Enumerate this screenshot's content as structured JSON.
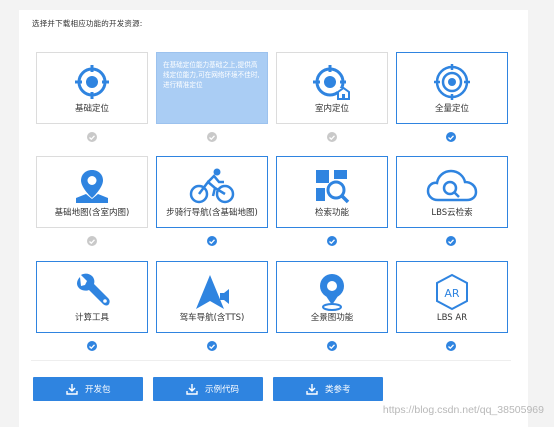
{
  "colors": {
    "accent": "#2f84e0",
    "info_bg": "#aacdf4",
    "unselected": "#c9c9c9"
  },
  "title": "选择并下载相应功能的开发资源:",
  "cards": [
    {
      "label": "基础定位",
      "icon": "crosshair-icon",
      "selected": false
    },
    {
      "label": "",
      "icon": "",
      "selected": false,
      "info_text": "在基础定位能力基础之上,提供高线定位能力,可在网络环境不佳时,进行精准定位"
    },
    {
      "label": "室内定位",
      "icon": "indoor-locate-icon",
      "selected": false
    },
    {
      "label": "全量定位",
      "icon": "full-locate-icon",
      "selected": true
    },
    {
      "label": "基础地图(含室内图)",
      "icon": "map-pin-icon",
      "selected": false
    },
    {
      "label": "步骑行导航(含基础地图)",
      "icon": "bicycle-icon",
      "selected": true
    },
    {
      "label": "检索功能",
      "icon": "search-grid-icon",
      "selected": true
    },
    {
      "label": "LBS云检索",
      "icon": "cloud-search-icon",
      "selected": true
    },
    {
      "label": "计算工具",
      "icon": "wrench-icon",
      "selected": true
    },
    {
      "label": "驾车导航(含TTS)",
      "icon": "nav-arrow-icon",
      "selected": true
    },
    {
      "label": "全景图功能",
      "icon": "panorama-pin-icon",
      "selected": true
    },
    {
      "label": "LBS AR",
      "icon": "ar-hex-icon",
      "selected": true
    }
  ],
  "buttons": [
    {
      "label": "开发包",
      "icon": "download-icon"
    },
    {
      "label": "示例代码",
      "icon": "download-icon"
    },
    {
      "label": "类参考",
      "icon": "download-icon"
    }
  ],
  "watermark": "https://blog.csdn.net/qq_38505969"
}
